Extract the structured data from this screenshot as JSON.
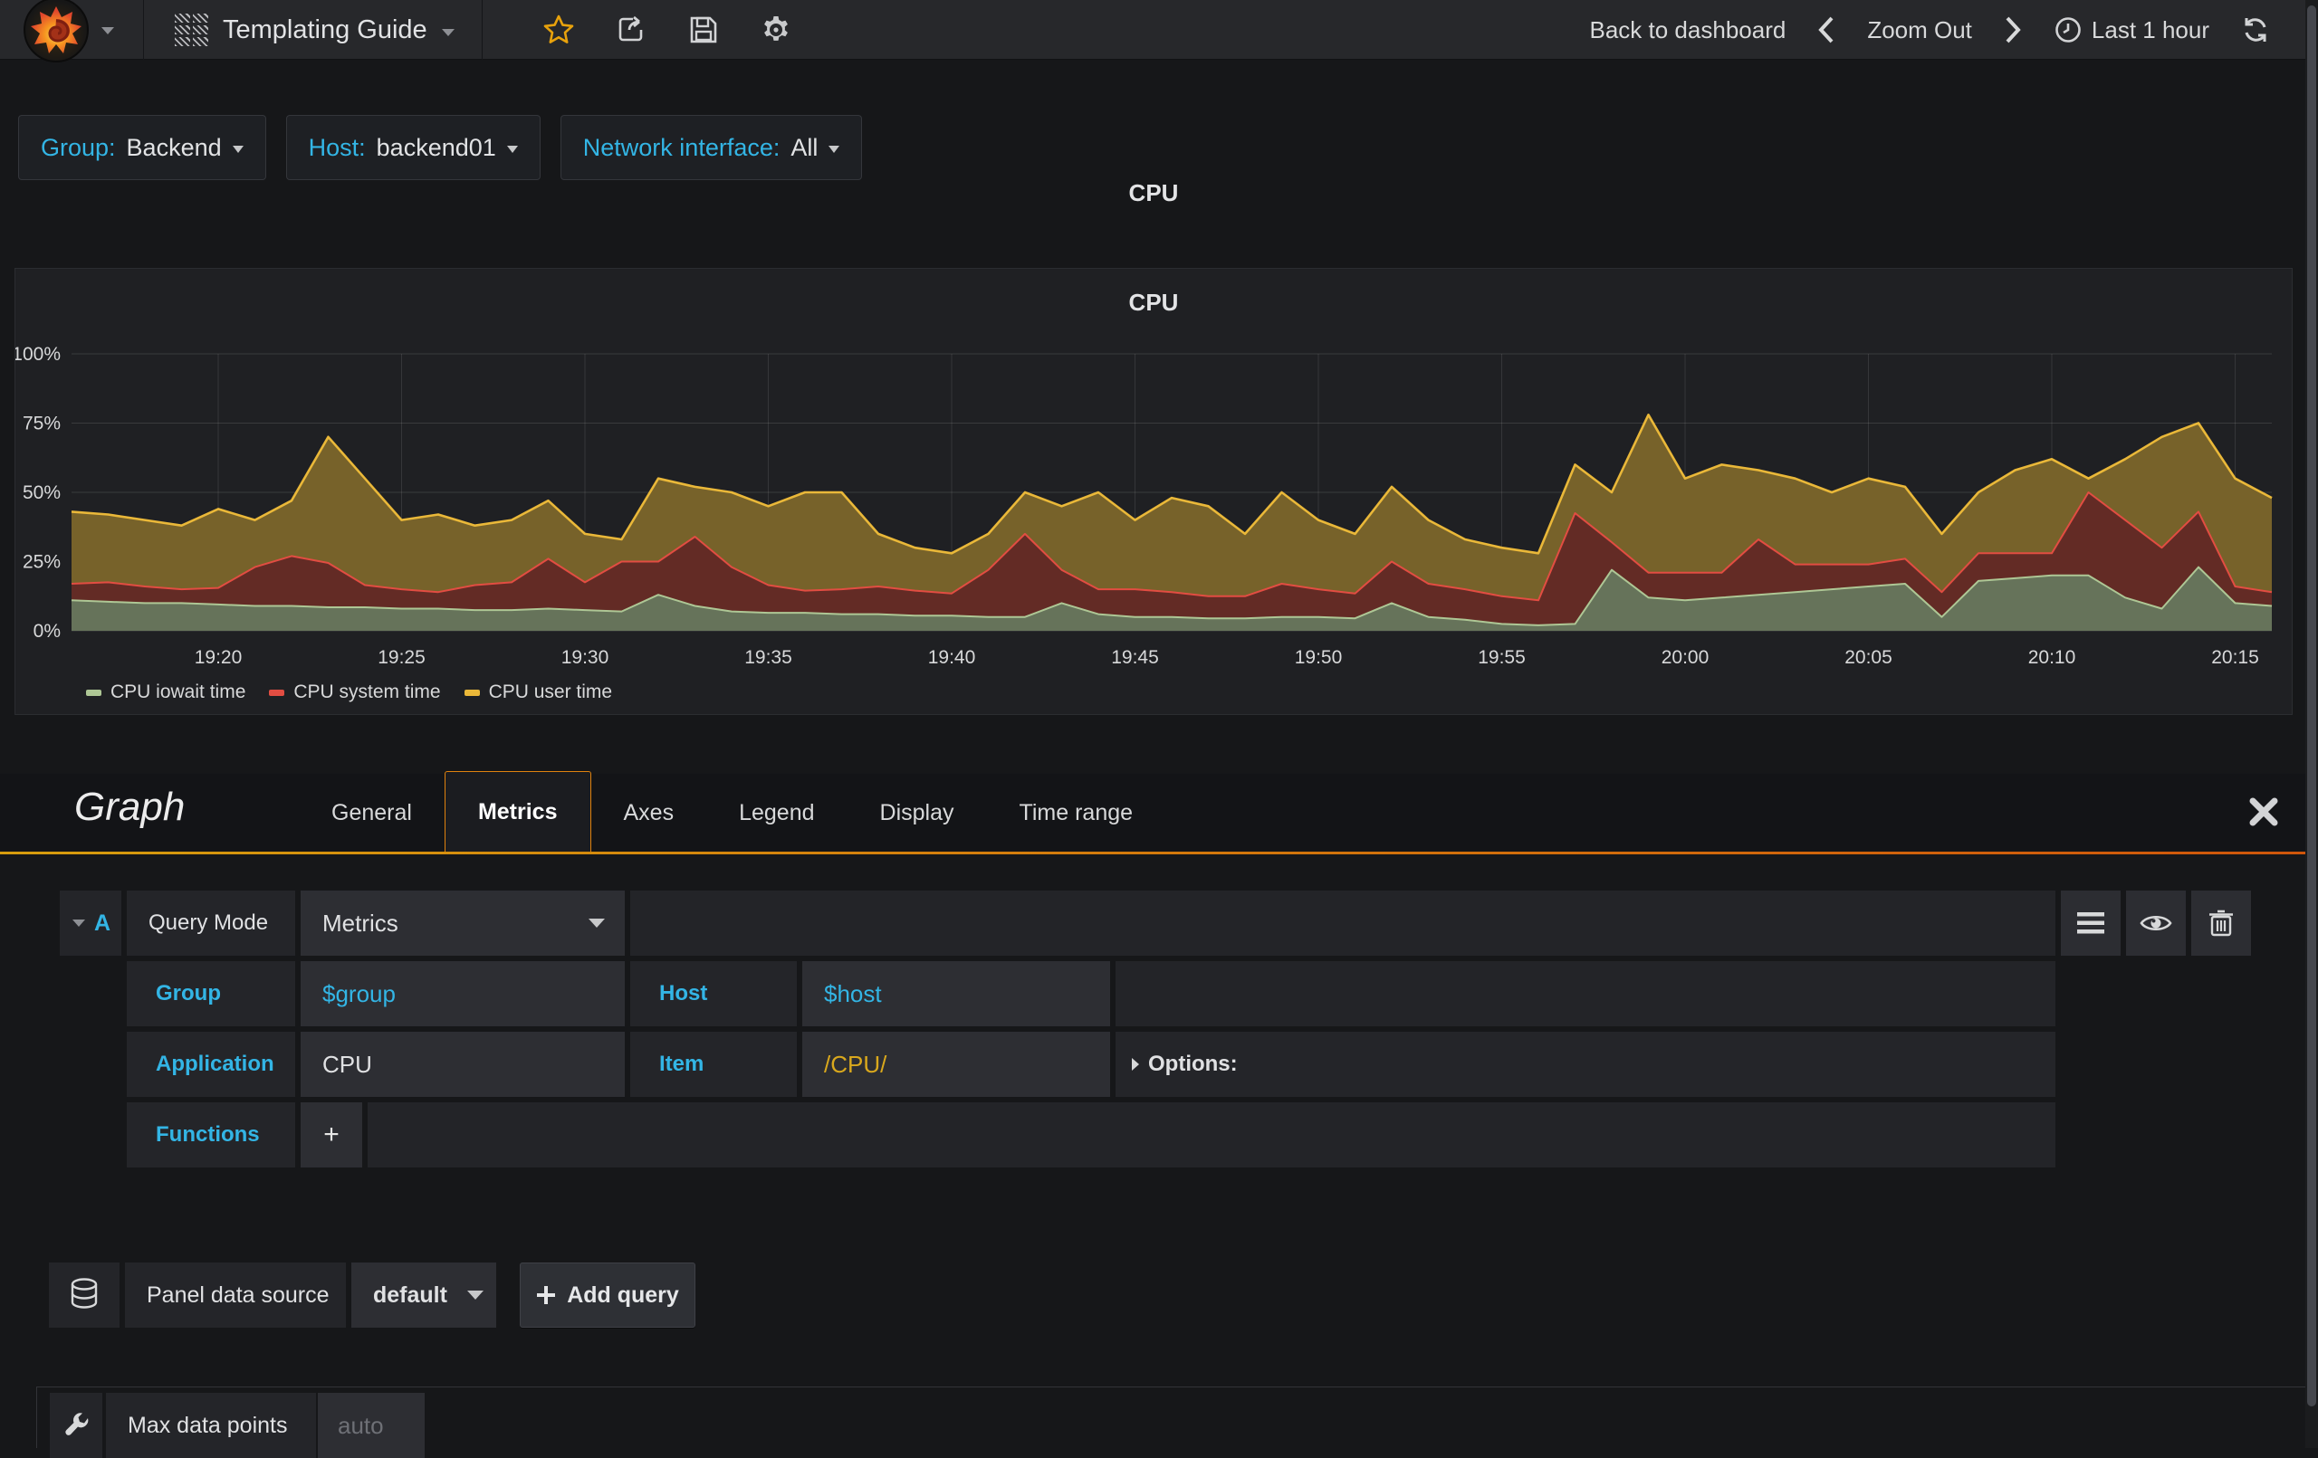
{
  "navbar": {
    "title": "Templating Guide",
    "icons": [
      "grafana-logo",
      "dashboard-grid",
      "star",
      "share",
      "save",
      "settings",
      "clock",
      "refresh"
    ],
    "back_label": "Back to dashboard",
    "zoom_out_label": "Zoom Out",
    "time_range_label": "Last 1 hour",
    "accent_color": "#e8a20c"
  },
  "variables": [
    {
      "label": "Group:",
      "value": "Backend"
    },
    {
      "label": "Host:",
      "value": "backend01"
    },
    {
      "label": "Network interface:",
      "value": "All"
    }
  ],
  "panel": {
    "header_title": "CPU",
    "chart_title": "CPU"
  },
  "editor": {
    "panel_type_label": "Graph",
    "tabs": [
      "General",
      "Metrics",
      "Axes",
      "Legend",
      "Display",
      "Time range"
    ],
    "active_tab": "Metrics",
    "query": {
      "ref_id": "A",
      "query_mode_label": "Query Mode",
      "query_mode_value": "Metrics",
      "group_label": "Group",
      "group_value": "$group",
      "host_label": "Host",
      "host_value": "$host",
      "application_label": "Application",
      "application_value": "CPU",
      "item_label": "Item",
      "item_value": "/CPU/",
      "options_label": "Options:",
      "functions_label": "Functions",
      "add_function_label": "+"
    },
    "datasource": {
      "label": "Panel data source",
      "value": "default",
      "add_query_label": "Add query"
    },
    "metrics_options": {
      "max_data_points_label": "Max data points",
      "max_data_points_placeholder": "auto"
    },
    "accent_colors": {
      "label_blue": "#33b5e5",
      "item_gold": "#d9a81d",
      "tab_orange": "#e0820e"
    }
  },
  "chart_data": {
    "type": "area",
    "stacked": true,
    "title": "CPU",
    "xlabel": "",
    "ylabel": "",
    "ylim": [
      0,
      100
    ],
    "grid": true,
    "legend_position": "bottom",
    "x_range_minutes": 60,
    "x_ticks": {
      "minutes": [
        4,
        9,
        14,
        19,
        24,
        29,
        34,
        39,
        44,
        49,
        54,
        59
      ],
      "labels": [
        "19:20",
        "19:25",
        "19:30",
        "19:35",
        "19:40",
        "19:45",
        "19:50",
        "19:55",
        "20:00",
        "20:05",
        "20:10",
        "20:15"
      ]
    },
    "y_ticks": {
      "values": [
        0,
        25,
        50,
        75,
        100
      ],
      "labels": [
        "0%",
        "25%",
        "50%",
        "75%",
        "100%"
      ]
    },
    "series": [
      {
        "name": "CPU iowait time",
        "color": "#AEC795",
        "fill": "#66735A",
        "values": [
          11,
          10.5,
          10,
          10,
          9.5,
          9,
          9,
          8.5,
          8.5,
          8,
          8,
          7.5,
          7.5,
          8,
          7.5,
          7,
          13,
          9,
          7,
          6.5,
          6.5,
          6,
          6,
          5.5,
          5.5,
          5,
          5,
          10,
          6,
          5,
          5,
          4.5,
          4.5,
          5,
          5,
          4.5,
          10,
          5,
          4,
          2.5,
          2,
          2.5,
          22,
          12,
          11,
          12,
          13,
          14,
          15,
          16,
          17,
          5,
          18,
          19,
          20,
          20,
          12,
          8,
          23,
          10,
          9
        ]
      },
      {
        "name": "CPU system time",
        "color": "#E24D42",
        "fill": "#632B25",
        "values": [
          6,
          7,
          6,
          5,
          6,
          14,
          18,
          16,
          8,
          7,
          6,
          9,
          10,
          18,
          10,
          18,
          12,
          25,
          16,
          10,
          8,
          9,
          10,
          9,
          8,
          17,
          30,
          12,
          9,
          10,
          9,
          8,
          8,
          12,
          10,
          9,
          15,
          12,
          11,
          10,
          9,
          40,
          10,
          9,
          10,
          9,
          20,
          10,
          9,
          8,
          9,
          9,
          10,
          9,
          8,
          30,
          28,
          22,
          20,
          6,
          5
        ]
      },
      {
        "name": "CPU user time",
        "color": "#EAB839",
        "fill": "#77622A",
        "values": [
          26,
          24.5,
          24,
          23,
          28.5,
          17,
          20,
          45.5,
          38.5,
          25,
          28,
          21.5,
          22.5,
          21,
          17.5,
          8,
          30,
          18,
          27,
          28.5,
          35.5,
          35,
          19,
          15.5,
          14.5,
          13,
          15,
          23,
          35,
          25,
          34,
          32.5,
          22.5,
          33,
          25,
          21.5,
          27,
          23,
          18,
          17.5,
          17,
          17.5,
          18,
          57,
          34,
          39,
          25,
          31,
          26,
          31,
          26,
          21,
          22,
          30,
          34,
          5,
          22,
          40,
          32,
          39,
          34
        ]
      }
    ]
  }
}
